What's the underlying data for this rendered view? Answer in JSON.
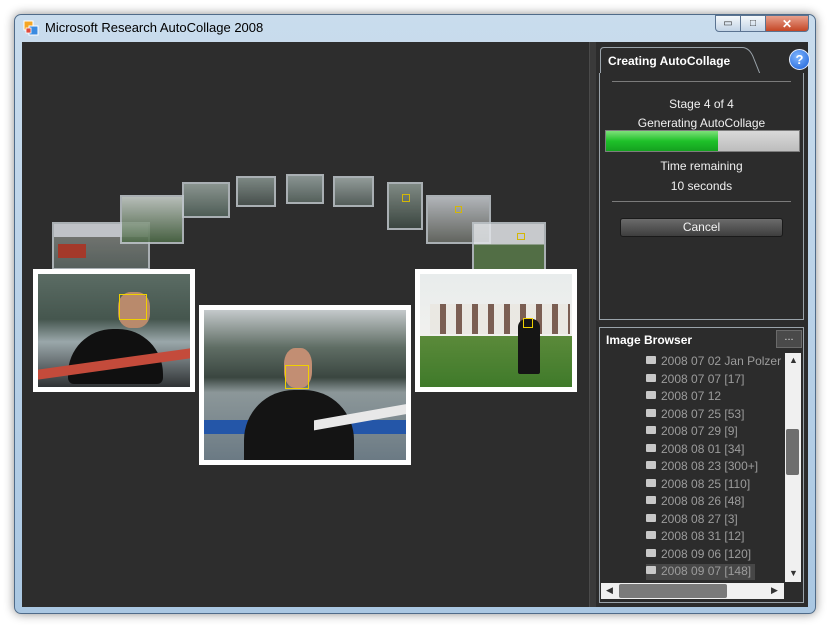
{
  "window": {
    "title": "Microsoft Research AutoCollage 2008",
    "minimize_glyph": "▭",
    "maximize_glyph": "□",
    "close_glyph": "✕"
  },
  "progress_panel": {
    "tab_title": "Creating AutoCollage",
    "help_glyph": "?",
    "stage": "Stage 4 of 4",
    "status": "Generating AutoCollage",
    "progress_fraction": 0.58,
    "time_label": "Time remaining",
    "time_value": "10 seconds",
    "cancel_label": "Cancel"
  },
  "image_browser": {
    "title": "Image Browser",
    "more_label": "...",
    "folders": [
      {
        "label": "2008 07 02 Jan Polzer",
        "selected": false
      },
      {
        "label": "2008 07 07  [17]",
        "selected": false
      },
      {
        "label": "2008 07 12",
        "selected": false
      },
      {
        "label": "2008 07 25  [53]",
        "selected": false
      },
      {
        "label": "2008 07 29  [9]",
        "selected": false
      },
      {
        "label": "2008 08 01  [34]",
        "selected": false
      },
      {
        "label": "2008 08 23  [300+]",
        "selected": false
      },
      {
        "label": "2008 08 25  [110]",
        "selected": false
      },
      {
        "label": "2008 08 26  [48]",
        "selected": false
      },
      {
        "label": "2008 08 27  [3]",
        "selected": false
      },
      {
        "label": "2008 08 31  [12]",
        "selected": false
      },
      {
        "label": "2008 09 06  [120]",
        "selected": false
      },
      {
        "label": "2008 09 07  [148]",
        "selected": true
      }
    ]
  },
  "colors": {
    "canvas_bg": "#2d2d2d",
    "progress_green": "#1fc12a",
    "face_box": "#f0d000",
    "selected_bg": "#474747"
  }
}
